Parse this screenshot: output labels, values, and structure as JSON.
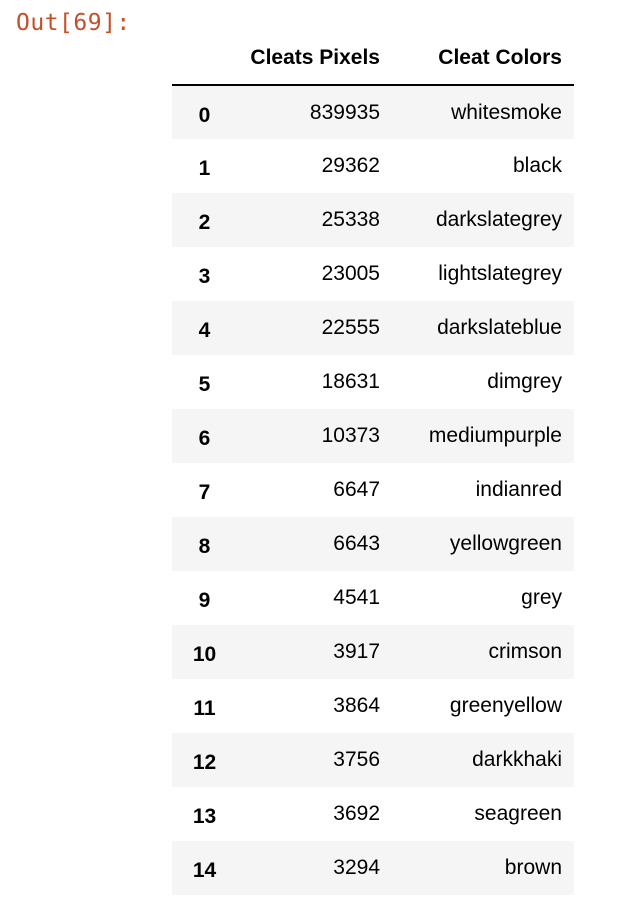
{
  "output_prompt": "Out[69]:",
  "table": {
    "columns": [
      "",
      "Cleats Pixels",
      "Cleat Colors"
    ],
    "rows": [
      {
        "index": "0",
        "pixels": "839935",
        "color": "whitesmoke"
      },
      {
        "index": "1",
        "pixels": "29362",
        "color": "black"
      },
      {
        "index": "2",
        "pixels": "25338",
        "color": "darkslategrey"
      },
      {
        "index": "3",
        "pixels": "23005",
        "color": "lightslategrey"
      },
      {
        "index": "4",
        "pixels": "22555",
        "color": "darkslateblue"
      },
      {
        "index": "5",
        "pixels": "18631",
        "color": "dimgrey"
      },
      {
        "index": "6",
        "pixels": "10373",
        "color": "mediumpurple"
      },
      {
        "index": "7",
        "pixels": "6647",
        "color": "indianred"
      },
      {
        "index": "8",
        "pixels": "6643",
        "color": "yellowgreen"
      },
      {
        "index": "9",
        "pixels": "4541",
        "color": "grey"
      },
      {
        "index": "10",
        "pixels": "3917",
        "color": "crimson"
      },
      {
        "index": "11",
        "pixels": "3864",
        "color": "greenyellow"
      },
      {
        "index": "12",
        "pixels": "3756",
        "color": "darkkhaki"
      },
      {
        "index": "13",
        "pixels": "3692",
        "color": "seagreen"
      },
      {
        "index": "14",
        "pixels": "3294",
        "color": "brown"
      }
    ]
  },
  "colors": {
    "prompt": "#c3502a",
    "stripe": "#f5f5f5"
  }
}
